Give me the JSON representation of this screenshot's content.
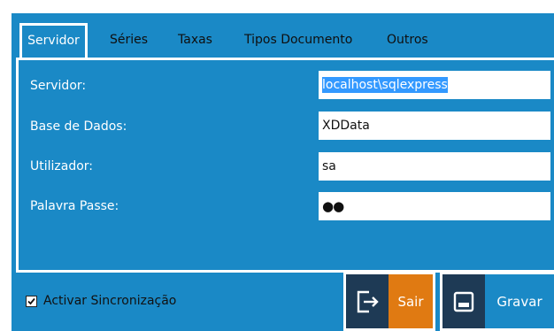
{
  "tabs": [
    {
      "label": "Servidor",
      "active": true
    },
    {
      "label": "Séries",
      "active": false
    },
    {
      "label": "Taxas",
      "active": false
    },
    {
      "label": "Tipos Documento",
      "active": false
    },
    {
      "label": "Outros",
      "active": false
    }
  ],
  "fields": {
    "servidor": {
      "label": "Servidor:",
      "value": "localhost\\sqlexpress"
    },
    "base_dados": {
      "label": "Base de Dados:",
      "value": "XDData"
    },
    "utilizador": {
      "label": "Utilizador:",
      "value": "sa"
    },
    "palavra_passe": {
      "label": "Palavra Passe:",
      "value": "●●"
    }
  },
  "sync": {
    "label": "Activar Sincronização",
    "checked": true
  },
  "buttons": {
    "sair_label": "Sair",
    "gravar_label": "Gravar"
  },
  "colors": {
    "panel": "#1a89c6",
    "button_icon_bg": "#1e3a55",
    "sair_bg": "#e07a12",
    "gravar_bg": "#1a89c6",
    "selection": "#3399ff"
  },
  "icons": {
    "sair": "exit-icon",
    "gravar": "save-icon"
  }
}
